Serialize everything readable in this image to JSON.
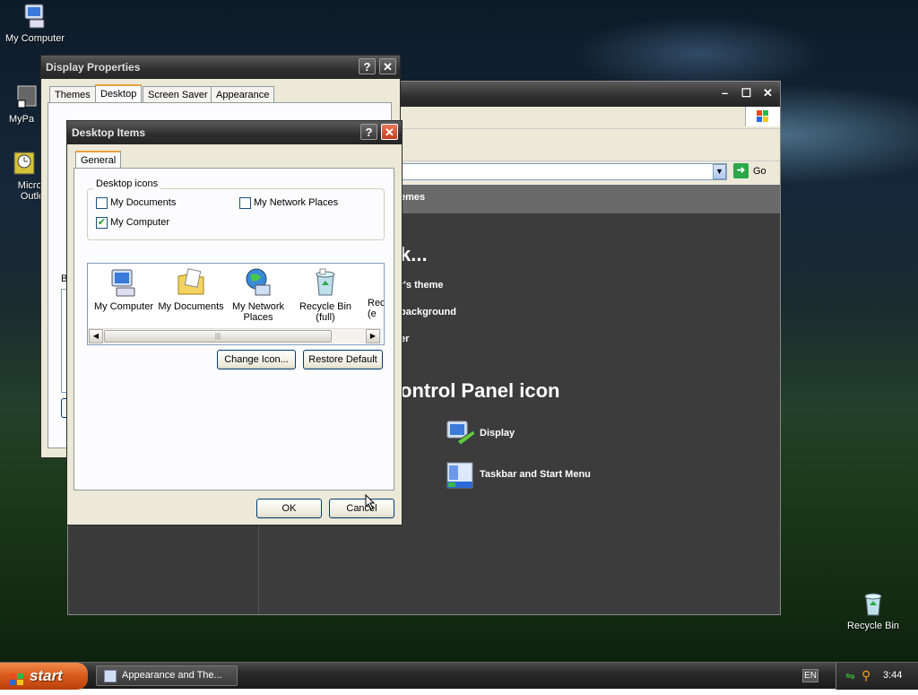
{
  "desktop_icons": [
    {
      "label": "My Computer",
      "icon": "my-computer-icon"
    },
    {
      "label": "MyPa",
      "icon": "shortcut-icon"
    },
    {
      "label": "Micros Outlo",
      "icon": "outlook-icon"
    },
    {
      "label": "Recycle Bin",
      "icon": "recycle-bin-icon"
    }
  ],
  "control_panel": {
    "address_go": "Go",
    "themes_fragment": "emes",
    "pick_task_fragment": "k...",
    "tasks": [
      "r's theme",
      "background",
      "er"
    ],
    "pick_icon_fragment": "ontrol Panel icon",
    "icons": [
      {
        "label": "Display",
        "icon": "display-icon"
      },
      {
        "label": "Taskbar and Start Menu",
        "icon": "taskbar-icon"
      }
    ]
  },
  "display_properties": {
    "title": "Display Properties",
    "tabs": [
      "Themes",
      "Desktop",
      "Screen Saver",
      "Appearance"
    ],
    "active_tab": "Desktop",
    "fragment_label": "B"
  },
  "desktop_items": {
    "title": "Desktop Items",
    "tab": "General",
    "group_label": "Desktop icons",
    "checkboxes": [
      {
        "label": "My Documents",
        "checked": false
      },
      {
        "label": "My Network Places",
        "checked": false
      },
      {
        "label": "My Computer",
        "checked": true
      }
    ],
    "icon_items": [
      {
        "label": "My Computer",
        "icon": "my-computer-icon"
      },
      {
        "label": "My Documents",
        "icon": "my-documents-icon"
      },
      {
        "label": "My Network Places",
        "icon": "network-places-icon"
      },
      {
        "label": "Recycle Bin (full)",
        "icon": "recycle-bin-full-icon"
      },
      {
        "label": "Rec (e",
        "icon": "recycle-bin-empty-icon"
      }
    ],
    "change_icon": "Change Icon...",
    "restore_default": "Restore Default",
    "ok": "OK",
    "cancel": "Cancel"
  },
  "taskbar": {
    "start": "start",
    "task_button": "Appearance and The...",
    "language": "EN",
    "clock": "3:44"
  },
  "colors": {
    "accent": "#e8a33c",
    "title_bg": "#2e2e2e",
    "cp_bg": "#3c3c3c"
  }
}
